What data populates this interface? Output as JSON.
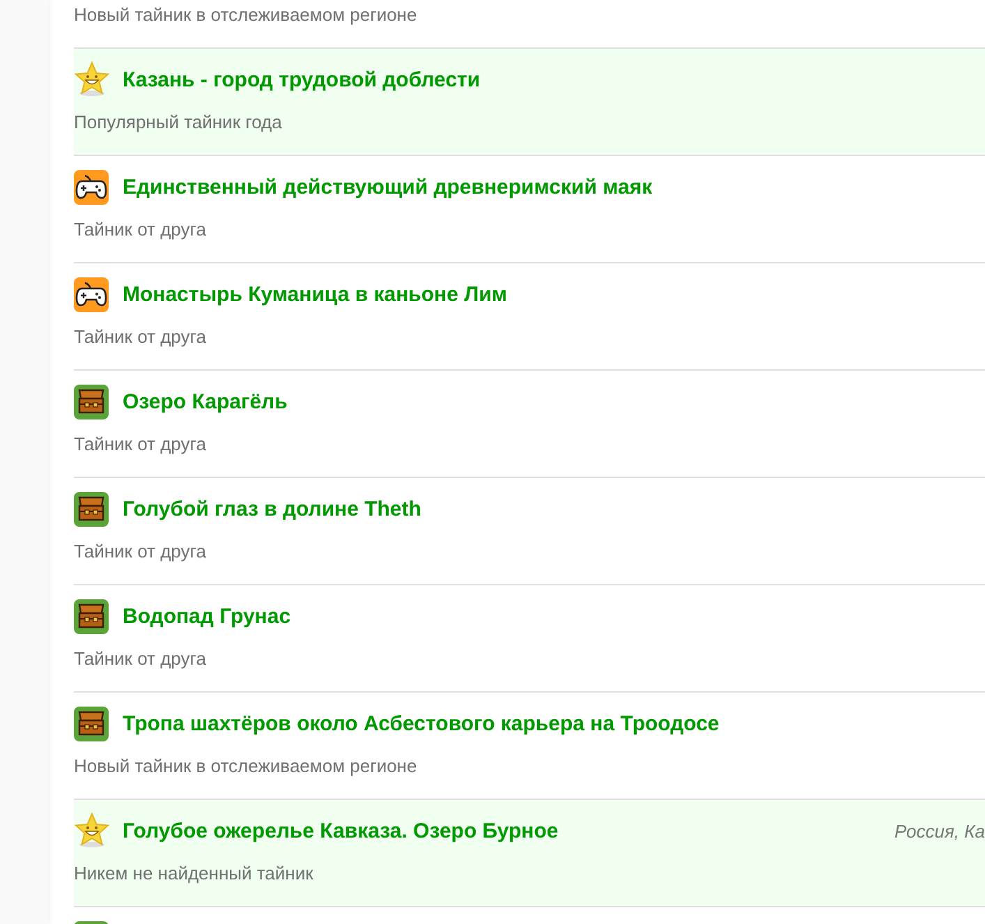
{
  "feed": [
    {
      "kind": "none",
      "highlighted": false,
      "subtitle": "Новый тайник в отслеживаемом регионе"
    },
    {
      "kind": "star",
      "highlighted": true,
      "title": "Казань - город трудовой доблести",
      "subtitle": "Популярный тайник года"
    },
    {
      "kind": "gamepad",
      "highlighted": false,
      "title": "Единственный действующий древнеримский маяк",
      "subtitle": "Тайник от друга"
    },
    {
      "kind": "gamepad",
      "highlighted": false,
      "title": "Монастырь Куманица в каньоне Лим",
      "subtitle": "Тайник от друга"
    },
    {
      "kind": "chest",
      "highlighted": false,
      "title": "Озеро Карагёль",
      "subtitle": "Тайник от друга"
    },
    {
      "kind": "chest",
      "highlighted": false,
      "title": "Голубой глаз в долине Theth",
      "subtitle": "Тайник от друга"
    },
    {
      "kind": "chest",
      "highlighted": false,
      "title": "Водопад Грунас",
      "subtitle": "Тайник от друга"
    },
    {
      "kind": "chest",
      "highlighted": false,
      "title": "Тропа шахтёров около Асбестового карьера на Троодосе",
      "subtitle": "Новый тайник в отслеживаемом регионе"
    },
    {
      "kind": "star",
      "highlighted": true,
      "title": "Голубое ожерелье Кавказа. Озеро Бурное",
      "location": "Россия, Ка",
      "subtitle": "Никем не найденный тайник"
    },
    {
      "kind": "chest",
      "highlighted": false
    }
  ]
}
